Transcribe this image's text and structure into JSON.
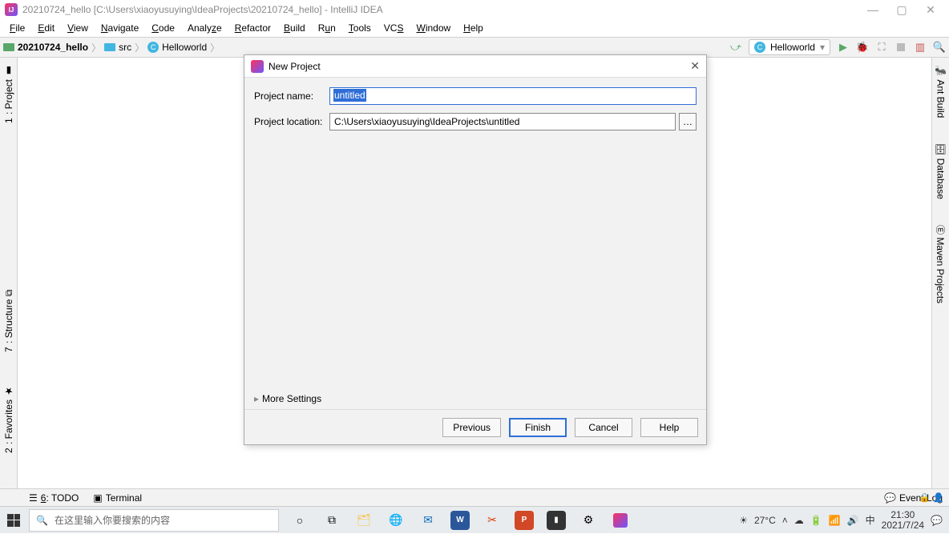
{
  "titlebar": {
    "text": "20210724_hello [C:\\Users\\xiaoyusuying\\IdeaProjects\\20210724_hello] - IntelliJ IDEA"
  },
  "menu": [
    "File",
    "Edit",
    "View",
    "Navigate",
    "Code",
    "Analyze",
    "Refactor",
    "Build",
    "Run",
    "Tools",
    "VCS",
    "Window",
    "Help"
  ],
  "breadcrumbs": [
    {
      "icon": "folder",
      "label": "20210724_hello"
    },
    {
      "icon": "folder-blue",
      "label": "src"
    },
    {
      "icon": "class",
      "label": "Helloworld"
    }
  ],
  "run_config": {
    "label": "Helloworld"
  },
  "left_tabs": [
    {
      "label": "1: Project",
      "name": "project-tab"
    },
    {
      "label": "7: Structure",
      "name": "structure-tab"
    },
    {
      "label": "2: Favorites",
      "name": "favorites-tab"
    }
  ],
  "right_tabs": [
    {
      "label": "Ant Build",
      "name": "ant-tab"
    },
    {
      "label": "Database",
      "name": "database-tab"
    },
    {
      "label": "Maven Projects",
      "name": "maven-tab"
    }
  ],
  "bottom_tabs": {
    "todo": "6: TODO",
    "terminal": "Terminal",
    "eventlog": "Event Log"
  },
  "dialog": {
    "title": "New Project",
    "name_label": "Project name:",
    "name_value": "untitled",
    "location_label": "Project location:",
    "location_value": "C:\\Users\\xiaoyusuying\\IdeaProjects\\untitled",
    "more": "More Settings",
    "previous": "Previous",
    "finish": "Finish",
    "cancel": "Cancel",
    "help": "Help"
  },
  "taskbar": {
    "search_placeholder": "在这里输入你要搜索的内容",
    "weather": "27°C",
    "ime": "中",
    "time": "21:30",
    "date": "2021/7/24"
  }
}
